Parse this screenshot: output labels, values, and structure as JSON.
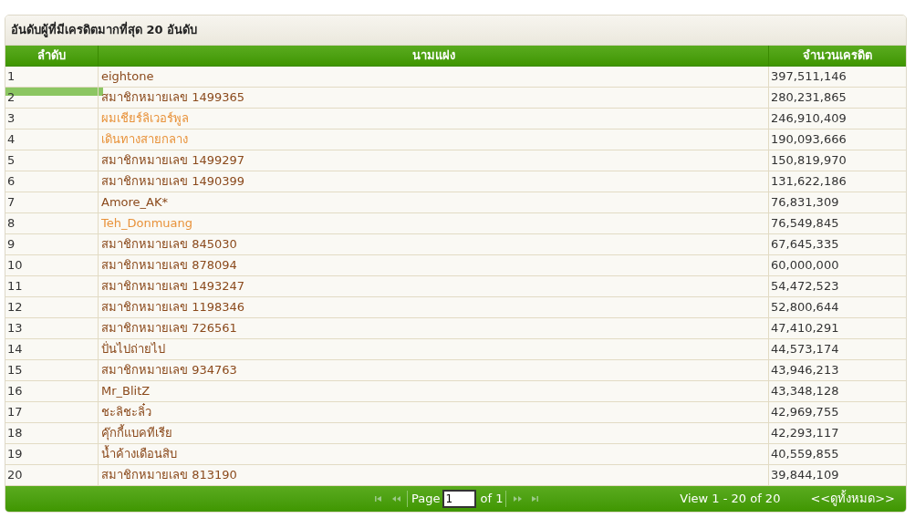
{
  "title": "อันดับผู้ที่มีเครดิตมากที่สุด 20 อันดับ",
  "table": {
    "columns": [
      "ลำดับ",
      "นามแฝง",
      "จำนวนเครดิต"
    ],
    "rows": [
      {
        "rank": "1",
        "name": "eightone",
        "credits": "397,511,146",
        "color": "#8b4a1c"
      },
      {
        "rank": "2",
        "name": "สมาชิกหมายเลข 1499365",
        "credits": "280,231,865",
        "color": "#8b4a1c"
      },
      {
        "rank": "3",
        "name": "ผมเชียร์ลิเวอร์พูล",
        "credits": "246,910,409",
        "color": "#e8923a"
      },
      {
        "rank": "4",
        "name": "เดินทางสายกลาง",
        "credits": "190,093,666",
        "color": "#e8923a"
      },
      {
        "rank": "5",
        "name": "สมาชิกหมายเลข 1499297",
        "credits": "150,819,970",
        "color": "#8b4a1c"
      },
      {
        "rank": "6",
        "name": "สมาชิกหมายเลข 1490399",
        "credits": "131,622,186",
        "color": "#8b4a1c"
      },
      {
        "rank": "7",
        "name": "Amore_AK*",
        "credits": "76,831,309",
        "color": "#8b4a1c"
      },
      {
        "rank": "8",
        "name": "Teh_Donmuang",
        "credits": "76,549,845",
        "color": "#e8923a"
      },
      {
        "rank": "9",
        "name": "สมาชิกหมายเลข 845030",
        "credits": "67,645,335",
        "color": "#8b4a1c"
      },
      {
        "rank": "10",
        "name": "สมาชิกหมายเลข 878094",
        "credits": "60,000,000",
        "color": "#8b4a1c"
      },
      {
        "rank": "11",
        "name": "สมาชิกหมายเลข 1493247",
        "credits": "54,472,523",
        "color": "#8b4a1c"
      },
      {
        "rank": "12",
        "name": "สมาชิกหมายเลข 1198346",
        "credits": "52,800,644",
        "color": "#8b4a1c"
      },
      {
        "rank": "13",
        "name": "สมาชิกหมายเลข 726561",
        "credits": "47,410,291",
        "color": "#8b4a1c"
      },
      {
        "rank": "14",
        "name": "ปั่นไปถ่ายไป",
        "credits": "44,573,174",
        "color": "#8b4a1c"
      },
      {
        "rank": "15",
        "name": "สมาชิกหมายเลข 934763",
        "credits": "43,946,213",
        "color": "#8b4a1c"
      },
      {
        "rank": "16",
        "name": "Mr_BlitZ",
        "credits": "43,348,128",
        "color": "#8b4a1c"
      },
      {
        "rank": "17",
        "name": "ชะลิชะลิ๋ว",
        "credits": "42,969,755",
        "color": "#8b4a1c"
      },
      {
        "rank": "18",
        "name": "คุ๊กกี้แบคทีเรีย",
        "credits": "42,293,117",
        "color": "#8b4a1c"
      },
      {
        "rank": "19",
        "name": "น้ำค้างเดือนสิบ",
        "credits": "40,559,855",
        "color": "#8b4a1c"
      },
      {
        "rank": "20",
        "name": "สมาชิกหมายเลข 813190",
        "credits": "39,844,109",
        "color": "#8b4a1c"
      }
    ]
  },
  "pager": {
    "page_label": "Page",
    "page_value": "1",
    "of_label": "of 1",
    "first_disabled": true,
    "prev_disabled": true,
    "next_disabled": true,
    "last_disabled": true,
    "view_text": "View 1 - 20 of 20",
    "view_all_link": "<<ดูทั้งหมด>>"
  }
}
